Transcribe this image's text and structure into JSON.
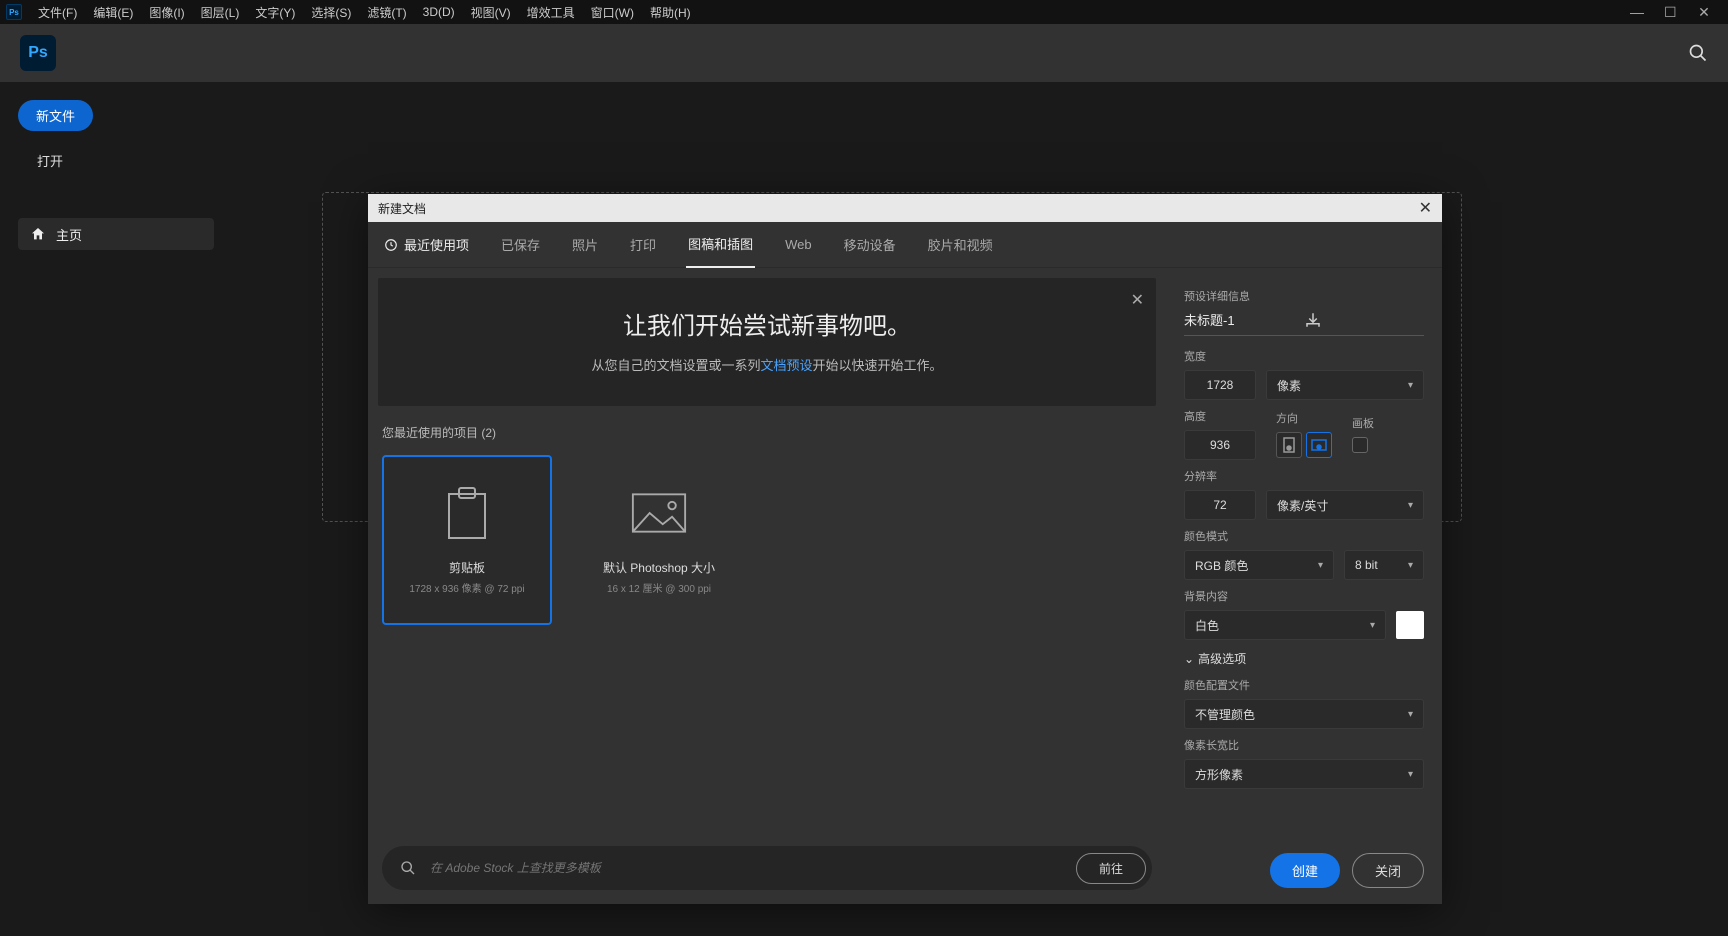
{
  "menubar": {
    "items": [
      "文件(F)",
      "编辑(E)",
      "图像(I)",
      "图层(L)",
      "文字(Y)",
      "选择(S)",
      "滤镜(T)",
      "3D(D)",
      "视图(V)",
      "增效工具",
      "窗口(W)",
      "帮助(H)"
    ]
  },
  "left": {
    "newfile": "新文件",
    "open": "打开",
    "home": "主页"
  },
  "dialog": {
    "title": "新建文档",
    "tabs": [
      "最近使用项",
      "已保存",
      "照片",
      "打印",
      "图稿和插图",
      "Web",
      "移动设备",
      "胶片和视频"
    ],
    "active_tab_index": 4,
    "banner": {
      "title": "让我们开始尝试新事物吧。",
      "pre": "从您自己的文档设置或一系列",
      "link": "文档预设",
      "post": "开始以快速开始工作。"
    },
    "recent_label": "您最近使用的项目 (2)",
    "presets": [
      {
        "name": "剪贴板",
        "detail": "1728 x 936 像素 @ 72 ppi",
        "selected": true,
        "icon": "clipboard"
      },
      {
        "name": "默认 Photoshop 大小",
        "detail": "16 x 12 厘米 @ 300 ppi",
        "selected": false,
        "icon": "image"
      }
    ],
    "stock": {
      "placeholder": "在 Adobe Stock 上查找更多模板",
      "go": "前往"
    },
    "details": {
      "heading": "预设详细信息",
      "docname": "未标题-1",
      "width_label": "宽度",
      "width": "1728",
      "width_unit": "像素",
      "height_label": "高度",
      "height": "936",
      "orient_label": "方向",
      "artboard_label": "画板",
      "res_label": "分辨率",
      "res": "72",
      "res_unit": "像素/英寸",
      "cmode_label": "颜色模式",
      "cmode": "RGB 颜色",
      "cdepth": "8 bit",
      "bg_label": "背景内容",
      "bg": "白色",
      "advanced": "高级选项",
      "profile_label": "颜色配置文件",
      "profile": "不管理颜色",
      "aspect_label": "像素长宽比",
      "aspect": "方形像素"
    },
    "actions": {
      "create": "创建",
      "close": "关闭"
    }
  }
}
